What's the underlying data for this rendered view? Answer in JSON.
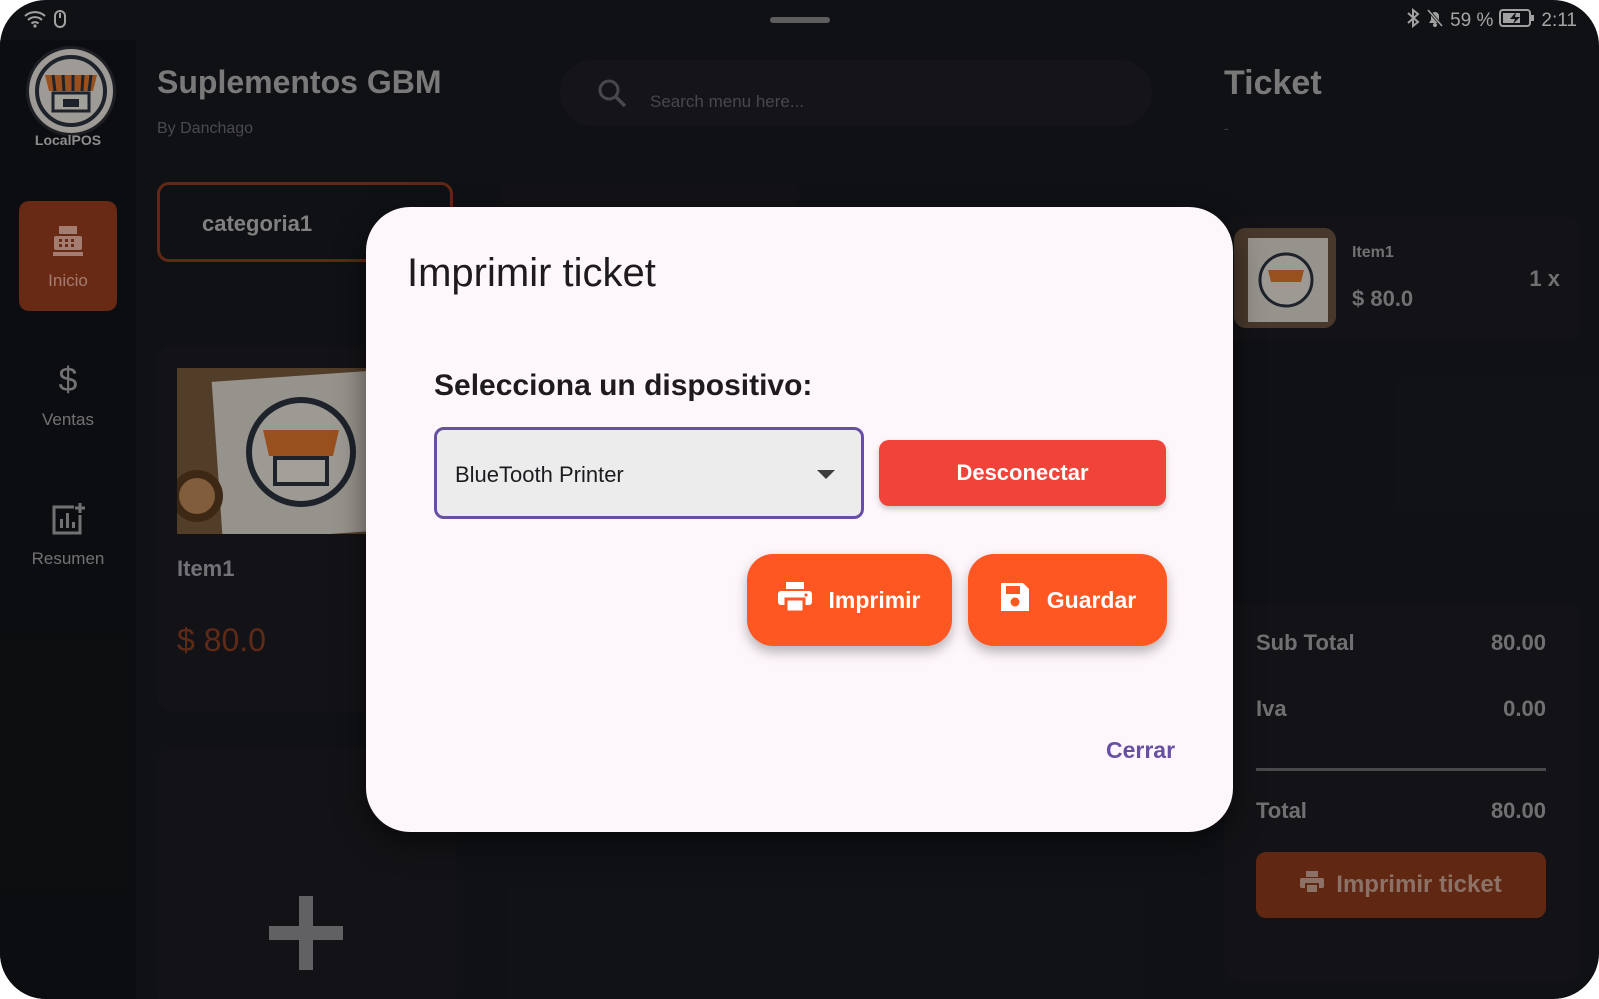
{
  "status_bar": {
    "battery": "59 %",
    "time": "2:11"
  },
  "sidebar": {
    "logo_label": "LocalPOS",
    "items": [
      {
        "label": "Inicio",
        "icon": "cash-register-icon",
        "active": true
      },
      {
        "label": "Ventas",
        "icon": "dollar-icon",
        "active": false
      },
      {
        "label": "Resumen",
        "icon": "add-chart-icon",
        "active": false
      }
    ]
  },
  "header": {
    "title": "Suplementos GBM",
    "subtitle": "By Danchago"
  },
  "search": {
    "placeholder": "Search menu here..."
  },
  "categories": [
    {
      "label": "categoria1"
    }
  ],
  "products": [
    {
      "name": "Item1",
      "price": "$ 80.0"
    }
  ],
  "ticket": {
    "title": "Ticket",
    "subtitle": "-",
    "items": [
      {
        "name": "Item1",
        "price": "$ 80.0",
        "qty": "1 x"
      }
    ],
    "subtotal_label": "Sub Total",
    "subtotal_value": "80.00",
    "iva_label": "Iva",
    "iva_value": "0.00",
    "total_label": "Total",
    "total_value": "80.00",
    "print_label": "Imprimir ticket"
  },
  "dialog": {
    "title": "Imprimir ticket",
    "device_label": "Selecciona un dispositivo:",
    "device_selected": "BlueTooth Printer",
    "disconnect_label": "Desconectar",
    "print_label": "Imprimir",
    "save_label": "Guardar",
    "close_label": "Cerrar"
  },
  "colors": {
    "accent": "#ff5722",
    "danger": "#f0443a",
    "primary": "#6750a4",
    "dialog_bg": "#fdf6fb",
    "app_bg": "#191a1f"
  }
}
